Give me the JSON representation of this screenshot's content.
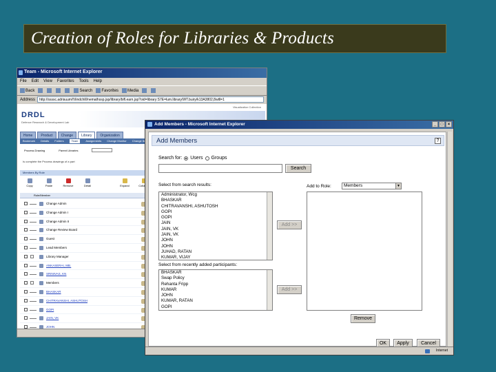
{
  "slide": {
    "title": "Creation of Roles for Libraries & Products"
  },
  "back_window": {
    "title": "Team - Microsoft Internet Explorer",
    "menu": [
      "File",
      "Edit",
      "View",
      "Favorites",
      "Tools",
      "Help"
    ],
    "toolbar": [
      "Back",
      "Search",
      "Favorites",
      "Media"
    ],
    "address_label": "Address",
    "address": "http://ssssc.adrisuum/f:ilindchill/nemathssp.jsp/library/bifl.earn.jsp?oid=library:S7E=lum.library/WT.buiry/k13A3802,8wtll=1",
    "visualization": "Visualization Collection",
    "logo": "DRDL",
    "logo_sub": "Defence Research & Development Lab",
    "tabs": [
      "Home",
      "Product",
      "Change",
      "Library",
      "Organization"
    ],
    "subtabs": [
      "Bookmark",
      "Details",
      "Folders",
      "Team",
      "Assignments",
      "Change Monitor",
      "Change Items"
    ],
    "process_label": "Process Drawing",
    "parent_label": "Parent Libraries",
    "message": "Is complete the Process drawings of a part",
    "section": "Members By Role",
    "actions_left": [
      "Copy",
      "Paste",
      "Remove",
      "Detail"
    ],
    "actions_right": [
      "Expand",
      "Collapse"
    ],
    "member_header": "Role/Member",
    "rows": [
      {
        "label": "Change Admin",
        "link": false,
        "toggle": false
      },
      {
        "label": "Change Admin I",
        "link": false,
        "toggle": false
      },
      {
        "label": "Change Admin II",
        "link": false,
        "toggle": false
      },
      {
        "label": "Change Review Board",
        "link": false,
        "toggle": false
      },
      {
        "label": "Guest",
        "link": false,
        "toggle": false
      },
      {
        "label": "Lead Members",
        "link": false,
        "toggle": false
      },
      {
        "label": "Library Manager",
        "link": false,
        "toggle": true
      },
      {
        "label": "ANKASERAI, MB.",
        "link": true,
        "toggle": false
      },
      {
        "label": "SRINIVAS, KN",
        "link": true,
        "toggle": false
      },
      {
        "label": "Members",
        "link": false,
        "toggle": true
      },
      {
        "label": "BHASKAR",
        "link": true,
        "toggle": false
      },
      {
        "label": "CHITRAVANSHI, ASHUTOSH",
        "link": true,
        "toggle": false
      },
      {
        "label": "GOPI",
        "link": true,
        "toggle": false
      },
      {
        "label": "JAIN, VK",
        "link": true,
        "toggle": false
      },
      {
        "label": "JOHN",
        "link": true,
        "toggle": false
      }
    ]
  },
  "dialog": {
    "window_title": "Add Members - Microsoft Internet Explorer",
    "heading": "Add Members",
    "help_label": "?",
    "search_for_label": "Search for:",
    "radio_users": "Users",
    "radio_groups": "Groups",
    "search_value": "",
    "search_button": "Search",
    "results_label": "Select from search results:",
    "results": [
      "Administrator, Wcg",
      "BHASKAR",
      "CHITRAVANSHI, ASHUTOSH",
      "GOPI",
      "GOPI",
      "JAIN",
      "JAIN, VK",
      "JAIN, VK",
      "JOHN",
      "JOHN",
      "JUHAD, RATAN",
      "KUMAR, VIJAY"
    ],
    "recent_label": "Select from recently added participants:",
    "recent": [
      "BHASKAR",
      "Swap Policy",
      "Rehanta Fripp",
      "KUMAR",
      "JOHN",
      "KUMAR, RATAN",
      "GOPI"
    ],
    "add_role_label": "Add to Role:",
    "role_selected": "Members",
    "add_button_1": "Add >>",
    "add_button_2": "Add >>",
    "remove_button": "Remove",
    "ok_button": "OK",
    "apply_button": "Apply",
    "cancel_button": "Cancel",
    "status_zone": "Internet"
  }
}
